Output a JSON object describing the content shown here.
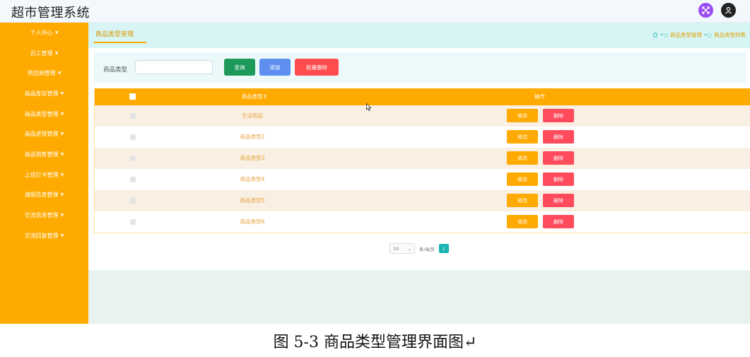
{
  "header": {
    "title": "超市管理系统"
  },
  "icons": {
    "fullscreen": "fullscreen-icon",
    "user": "user-icon",
    "home": "home-icon"
  },
  "sidebar": {
    "items": [
      {
        "label": "个人中心"
      },
      {
        "label": "员工管理"
      },
      {
        "label": "供应商管理"
      },
      {
        "label": "商品库存管理"
      },
      {
        "label": "商品类型管理"
      },
      {
        "label": "商品进货管理"
      },
      {
        "label": "商品销售管理"
      },
      {
        "label": "上班打卡管理"
      },
      {
        "label": "请假信息管理"
      },
      {
        "label": "交流信息管理"
      },
      {
        "label": "交流回复管理"
      }
    ]
  },
  "tabs": {
    "active": "商品类型管理"
  },
  "breadcrumb": {
    "items": [
      "商品类型管理",
      "商品类型列表"
    ]
  },
  "search": {
    "label": "商品类型",
    "value": "",
    "query_label": "查询",
    "add_label": "添加",
    "batch_delete_label": "批量删除"
  },
  "table": {
    "headers": {
      "name": "商品类型",
      "actions": "操作"
    },
    "rows": [
      {
        "name": "生活用品"
      },
      {
        "name": "商品类型2"
      },
      {
        "name": "商品类型3"
      },
      {
        "name": "商品类型4"
      },
      {
        "name": "商品类型5"
      },
      {
        "name": "商品类型6"
      }
    ],
    "edit_label": "修改",
    "delete_label": "删除"
  },
  "pagination": {
    "page_size": "10",
    "per_page_label": "条/每页",
    "current_page": "1"
  },
  "caption": "图 5-3 商品类型管理界面图↵",
  "colors": {
    "sidebar": "#ffaa00",
    "accent_teal": "#1bb3b3",
    "danger": "#ff4d4f",
    "primary_blue": "#5e8ff0",
    "success": "#1d9a5a"
  }
}
